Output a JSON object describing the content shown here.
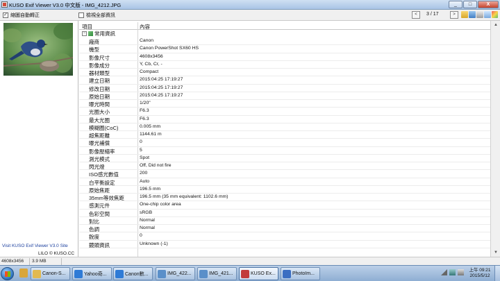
{
  "window": {
    "title": "KUSO Exif Viewer V3.0 中文版 - IMG_4212.JPG",
    "controls": {
      "minimize": "_",
      "maximize": "□",
      "close": "X"
    }
  },
  "toolbar": {
    "auto_rotate_label": "縮圖自動轉正",
    "auto_rotate_checked": true,
    "show_all_label": "檢視全部資訊",
    "show_all_checked": false,
    "prev_label": "<",
    "next_label": ">",
    "page_indicator": "3 / 17",
    "icons": [
      "open-folder-icon",
      "save-icon",
      "print-icon",
      "copy-icon",
      "color-icon",
      "info-icon"
    ]
  },
  "left_panel": {
    "thumbnail_alt": "bird-thumbnail",
    "site_text": "Visit KUSO Exif Viewer V3.0 Site",
    "copyright_text": "LILO © KUSO.CC"
  },
  "table": {
    "headers": {
      "item": "項目",
      "content": "內容"
    },
    "group_label": "常用資訊",
    "expander": "−",
    "rows": [
      {
        "key": "廠商",
        "value": "Canon"
      },
      {
        "key": "機型",
        "value": "Canon PowerShot SX60 HS"
      },
      {
        "key": "影像尺寸",
        "value": "4608x3456"
      },
      {
        "key": "影像成分",
        "value": "Y, Cb, Cr, -"
      },
      {
        "key": "器材類型",
        "value": "Compact"
      },
      {
        "key": "建立日期",
        "value": "2015:04:25 17:19:27"
      },
      {
        "key": "修改日期",
        "value": "2015:04:25 17:19:27"
      },
      {
        "key": "原始日期",
        "value": "2015:04:25 17:19:27"
      },
      {
        "key": "曝光時間",
        "value": "1/20\""
      },
      {
        "key": "光圈大小",
        "value": "F6.3"
      },
      {
        "key": "最大光圈",
        "value": "F6.3"
      },
      {
        "key": "模糊圈(CoC)",
        "value": "0.005 mm"
      },
      {
        "key": "超焦距離",
        "value": "1144.61 m"
      },
      {
        "key": "曝光補償",
        "value": "0"
      },
      {
        "key": "影像壓縮率",
        "value": "5"
      },
      {
        "key": "測光模式",
        "value": "Spot"
      },
      {
        "key": "閃光燈",
        "value": "Off, Did not fire"
      },
      {
        "key": "ISO感光數值",
        "value": "200"
      },
      {
        "key": "白平衡設定",
        "value": "Auto"
      },
      {
        "key": "原始焦距",
        "value": "196.5 mm"
      },
      {
        "key": "35mm等效焦距",
        "value": "196.5 mm (35 mm equivalent: 1102.6 mm)"
      },
      {
        "key": "感測元件",
        "value": "One-chip color area"
      },
      {
        "key": "色彩空間",
        "value": "sRGB"
      },
      {
        "key": "對比",
        "value": "Normal"
      },
      {
        "key": "色調",
        "value": "Normal"
      },
      {
        "key": "銳度",
        "value": "0"
      },
      {
        "key": "鏡頭資訊",
        "value": "Unknown (-1)"
      }
    ]
  },
  "status_bar": {
    "dimensions": "4608x3456",
    "file_size": "3.9 MB"
  },
  "taskbar": {
    "tasks": [
      {
        "label": "",
        "icon": "explorer-folder-icon",
        "color": "#d9a63a"
      },
      {
        "label": "Canon-S...",
        "icon": "folder-icon",
        "color": "#e2b950"
      },
      {
        "label": "Yahoo奇...",
        "icon": "ie-icon",
        "color": "#2f7bd6"
      },
      {
        "label": "Canon數...",
        "icon": "ie-icon",
        "color": "#2f7bd6"
      },
      {
        "label": "IMG_422...",
        "icon": "image-icon",
        "color": "#5a8fc9"
      },
      {
        "label": "IMG_421...",
        "icon": "image-icon",
        "color": "#5a8fc9"
      },
      {
        "label": "KUSO Ex...",
        "icon": "kuso-exif-icon",
        "color": "#c23b3b"
      },
      {
        "label": "PhotoIm...",
        "icon": "photoimpact-icon",
        "color": "#3b6ec2"
      }
    ],
    "clock": {
      "period_time": "上午 09:21",
      "date": "2015/5/12"
    }
  },
  "colors": {
    "titlebar": "#a9c4e6",
    "taskbar": "#8eaed3",
    "link_blue": "#1b3f9e"
  }
}
